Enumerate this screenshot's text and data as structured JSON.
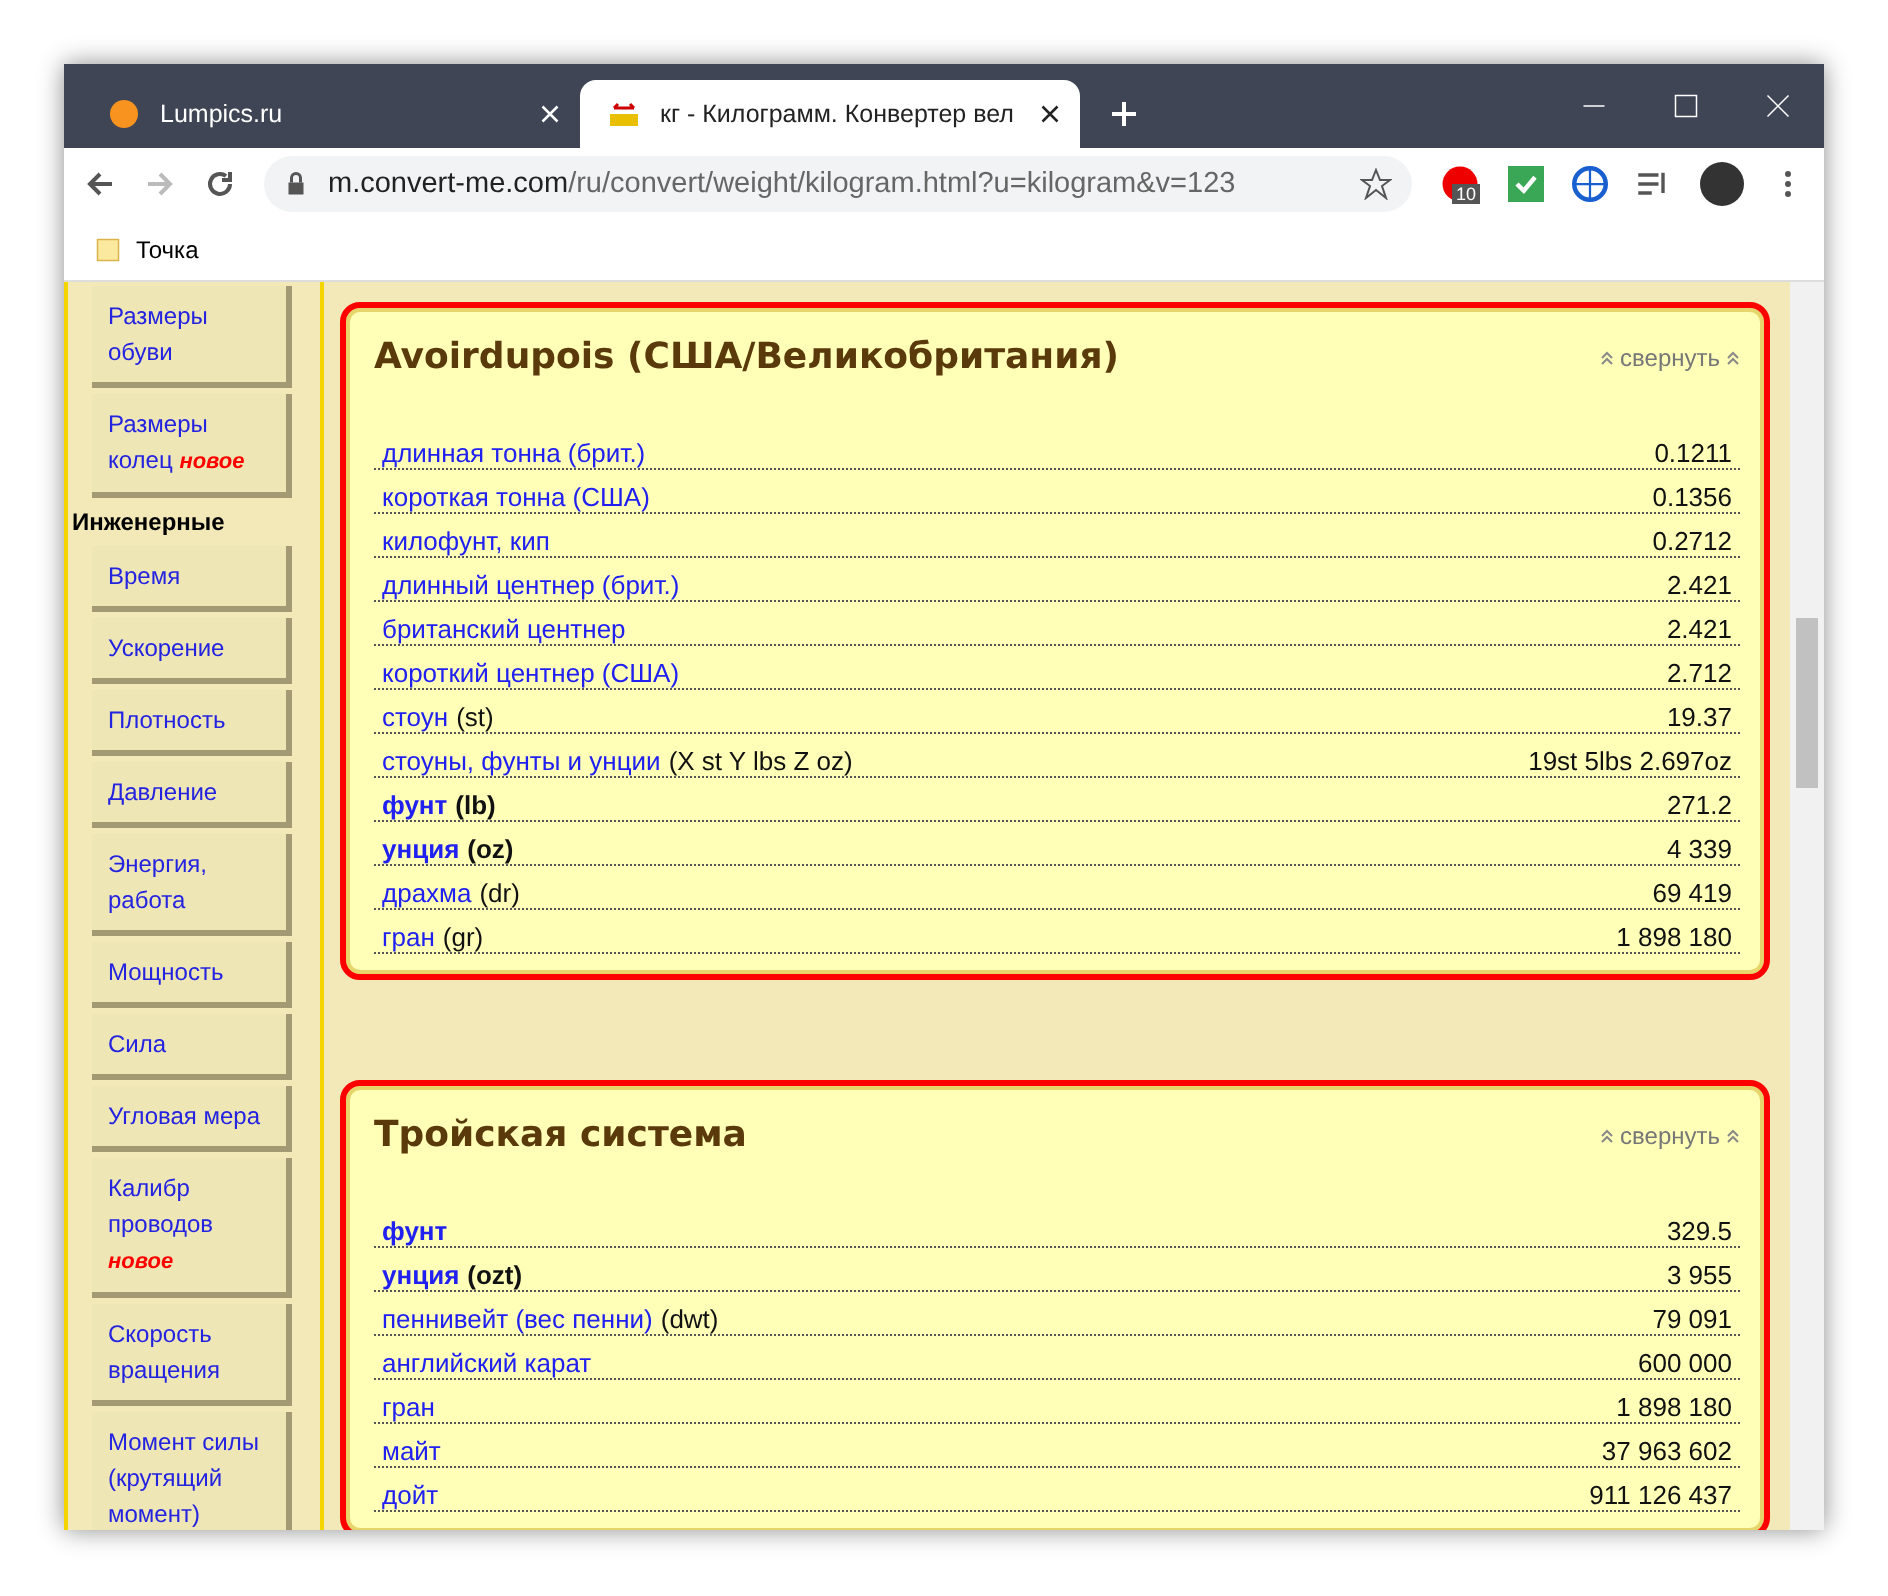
{
  "tabs": [
    {
      "title": "Lumpics.ru",
      "selected": false
    },
    {
      "title": "кг - Килограмм. Конвертер вел",
      "selected": true
    }
  ],
  "address": {
    "domain": "m.convert-me.com",
    "path": "/ru/convert/weight/kilogram.html?u=kilogram&v=123"
  },
  "extension_badge": "10",
  "bookmarks": [
    "Точка"
  ],
  "sidebar": [
    {
      "kind": "link",
      "label": "Размеры обуви"
    },
    {
      "kind": "link",
      "label": "Размеры колец",
      "badge": "новое"
    },
    {
      "kind": "heading",
      "label": "Инженерные"
    },
    {
      "kind": "link",
      "label": "Время"
    },
    {
      "kind": "link",
      "label": "Ускорение"
    },
    {
      "kind": "link",
      "label": "Плотность"
    },
    {
      "kind": "link",
      "label": "Давление"
    },
    {
      "kind": "link",
      "label": "Энергия, работа"
    },
    {
      "kind": "link",
      "label": "Мощность"
    },
    {
      "kind": "link",
      "label": "Сила"
    },
    {
      "kind": "link",
      "label": "Угловая мера"
    },
    {
      "kind": "link",
      "label": "Калибр проводов",
      "badge": "новое"
    },
    {
      "kind": "link",
      "label": "Скорость вращения"
    },
    {
      "kind": "link",
      "label": "Момент силы (крутящий момент)"
    }
  ],
  "sections": [
    {
      "title": "Avoirdupois (США/Великобритания)",
      "collapse": "свернуть",
      "rows": [
        {
          "unit": "длинная тонна (брит.)",
          "value": "0.1211",
          "bold": false
        },
        {
          "unit": "короткая тонна (США)",
          "value": "0.1356",
          "bold": false
        },
        {
          "unit": "килофунт, кип",
          "value": "0.2712",
          "bold": false
        },
        {
          "unit": "длинный центнер (брит.)",
          "value": "2.421",
          "bold": false
        },
        {
          "unit": "британский центнер",
          "value": "2.421",
          "bold": false
        },
        {
          "unit": "короткий центнер (США)",
          "value": "2.712",
          "bold": false
        },
        {
          "unit": "стоун",
          "symbol": "(st)",
          "value": "19.37",
          "bold": false
        },
        {
          "unit": "стоуны, фунты и унции",
          "symbol": "(X st Y lbs Z oz)",
          "value": "19st 5lbs 2.697oz",
          "bold": false
        },
        {
          "unit": "фунт",
          "symbol": "(lb)",
          "value": "271.2",
          "bold": true
        },
        {
          "unit": "унция",
          "symbol": "(oz)",
          "value": "4 339",
          "bold": true
        },
        {
          "unit": "драхма",
          "symbol": "(dr)",
          "value": "69 419",
          "bold": false
        },
        {
          "unit": "гран",
          "symbol": "(gr)",
          "value": "1 898 180",
          "bold": false
        }
      ]
    },
    {
      "title": "Тройская система",
      "collapse": "свернуть",
      "rows": [
        {
          "unit": "фунт",
          "value": "329.5",
          "bold": true
        },
        {
          "unit": "унция",
          "symbol": "(ozt)",
          "value": "3 955",
          "bold": true
        },
        {
          "unit": "пеннивейт (вес пенни)",
          "symbol": "(dwt)",
          "value": "79 091",
          "bold": false
        },
        {
          "unit": "английский карат",
          "value": "600 000",
          "bold": false
        },
        {
          "unit": "гран",
          "value": "1 898 180",
          "bold": false
        },
        {
          "unit": "майт",
          "value": "37 963 602",
          "bold": false
        },
        {
          "unit": "дойт",
          "value": "911 126 437",
          "bold": false
        }
      ]
    }
  ]
}
